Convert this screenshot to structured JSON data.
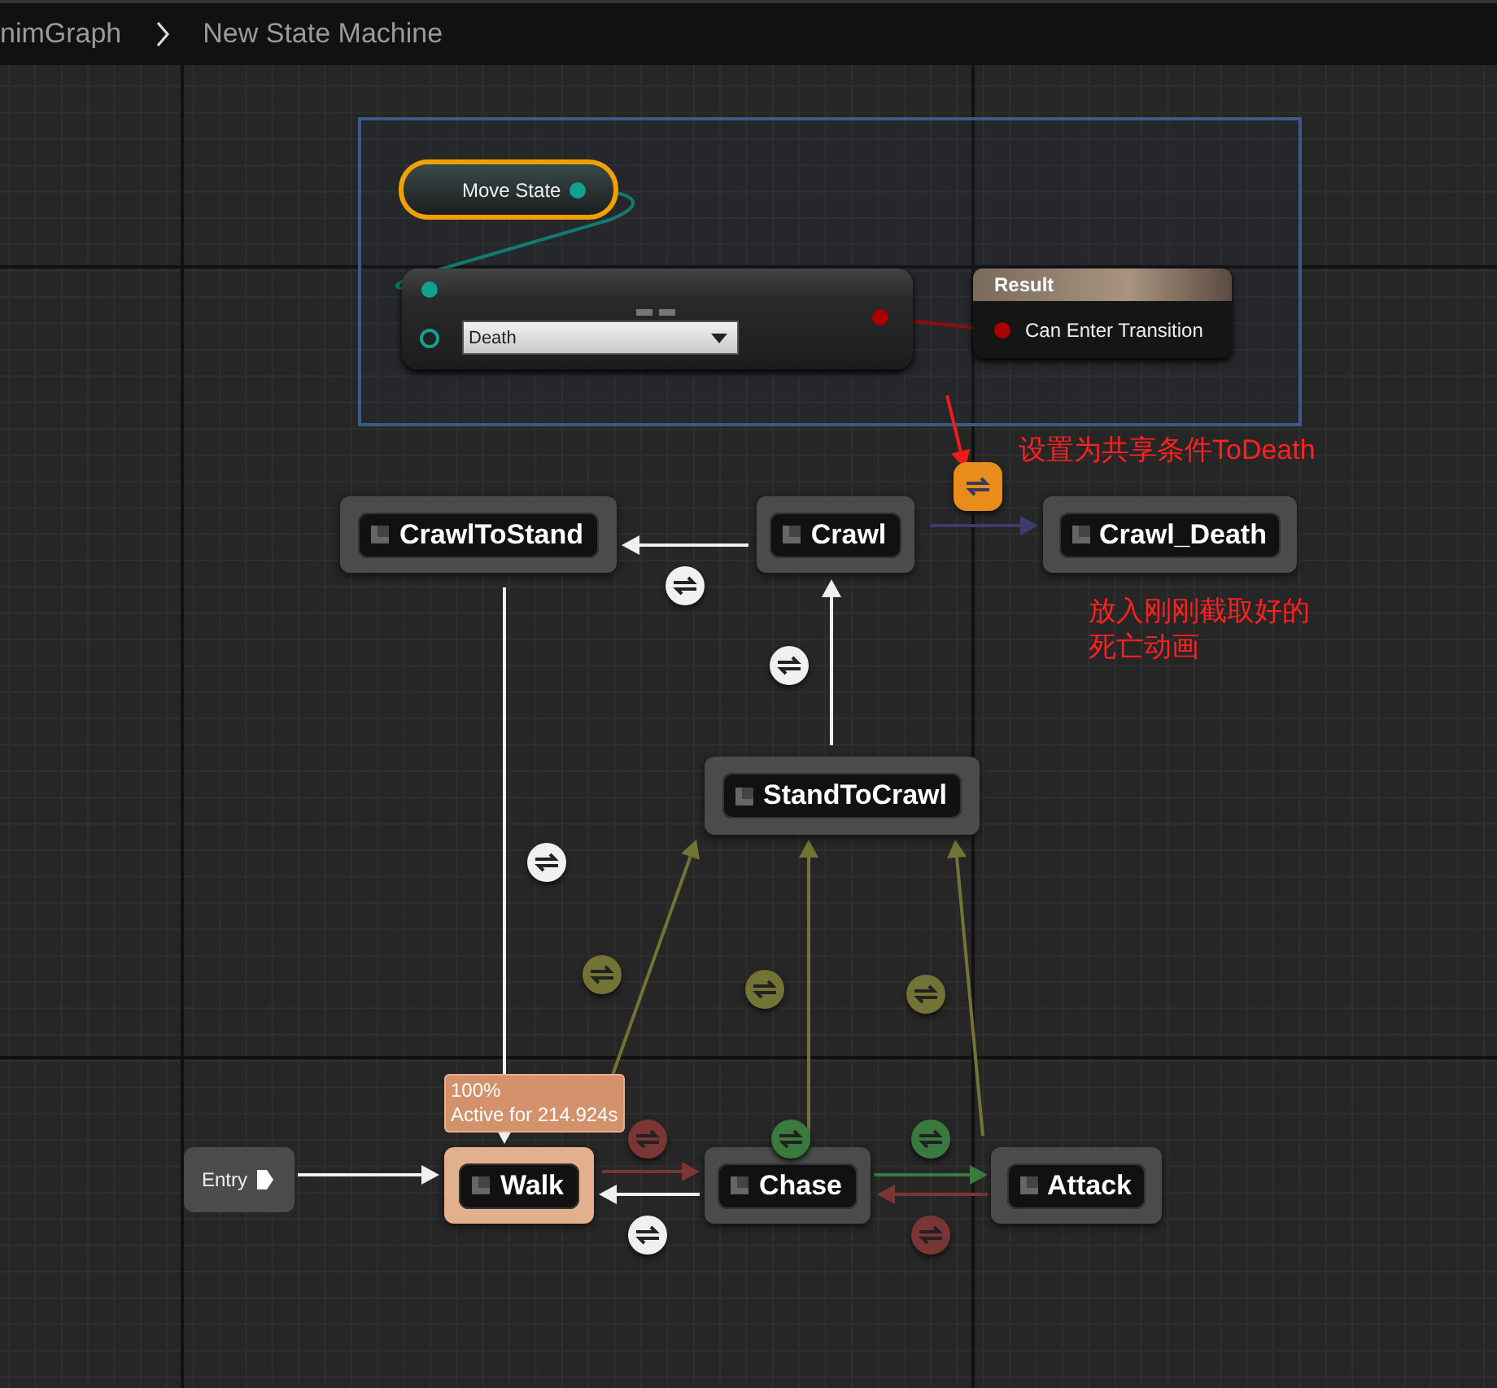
{
  "breadcrumb": {
    "items": [
      "nimGraph",
      "New State Machine"
    ]
  },
  "transition_graph": {
    "move_state": {
      "label": "Move State"
    },
    "compare": {
      "value": "Death"
    },
    "result": {
      "title": "Result",
      "pin_label": "Can Enter Transition"
    }
  },
  "annotations": [
    {
      "text": "设置为共享条件ToDeath"
    },
    {
      "text": "放入刚刚截取好的"
    },
    {
      "text": "死亡动画"
    }
  ],
  "entry": {
    "label": "Entry"
  },
  "states": [
    {
      "name": "CrawlToStand",
      "active": false
    },
    {
      "name": "Crawl",
      "active": false
    },
    {
      "name": "Crawl_Death",
      "active": false
    },
    {
      "name": "StandToCrawl",
      "active": false
    },
    {
      "name": "Walk",
      "active": true,
      "tooltip": [
        "100%",
        "Active for 214.924s"
      ]
    },
    {
      "name": "Chase",
      "active": false
    },
    {
      "name": "Attack",
      "active": false
    }
  ],
  "transitions": [
    {
      "kind": "normal",
      "color": "#f0f0f0"
    },
    {
      "kind": "normal",
      "color": "#f0f0f0"
    },
    {
      "kind": "normal",
      "color": "#f0f0f0"
    },
    {
      "kind": "normal",
      "color": "#f0f0f0"
    },
    {
      "kind": "normal",
      "color": "#737335"
    },
    {
      "kind": "normal",
      "color": "#737335"
    },
    {
      "kind": "normal",
      "color": "#737335"
    },
    {
      "kind": "normal",
      "color": "#7a3535"
    },
    {
      "kind": "normal",
      "color": "#7a3535"
    },
    {
      "kind": "normal",
      "color": "#3a7a3e"
    },
    {
      "kind": "normal",
      "color": "#3a7a3e"
    },
    {
      "kind": "shared",
      "color": "#e88c1c"
    }
  ]
}
